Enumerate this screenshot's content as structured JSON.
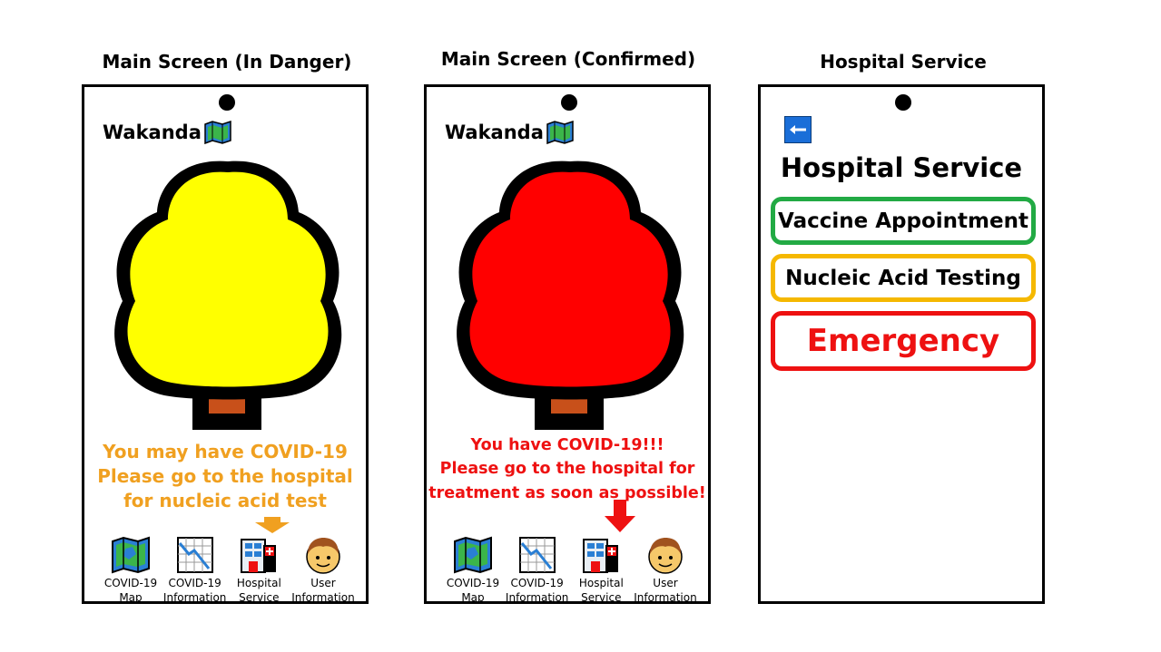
{
  "captions": {
    "danger": "Main Screen (In Danger)",
    "confirmed": "Main Screen (Confirmed)",
    "hospital": "Hospital Service"
  },
  "app": {
    "name": "Wakanda",
    "logo_icon": "folded-map-icon"
  },
  "danger_screen": {
    "tree_color": "#ffff00",
    "message_lines": [
      "You may have COVID-19",
      "Please go to the hospital",
      "for nucleic acid test"
    ],
    "message_color": "#f0a020",
    "arrow_color": "#f0a020"
  },
  "confirmed_screen": {
    "tree_color": "#ff0000",
    "message_lines": [
      "You have COVID-19!!!",
      "Please go to the hospital for",
      "treatment as soon as possible!"
    ],
    "message_color": "#ee1111",
    "arrow_color": "#ee1111"
  },
  "nav": {
    "map": {
      "line1": "COVID-19",
      "line2": "Map",
      "icon": "map-icon"
    },
    "info": {
      "line1": "COVID-19",
      "line2": "Information",
      "icon": "chart-decline-icon"
    },
    "hospital": {
      "line1": "Hospital",
      "line2": "Service",
      "icon": "hospital-icon"
    },
    "user": {
      "line1": "User",
      "line2": "Information",
      "icon": "user-face-icon"
    }
  },
  "hospital_screen": {
    "back_icon": "back-arrow-icon",
    "title": "Hospital Service",
    "buttons": [
      {
        "label": "Vaccine Appointment",
        "color": "#22aa44"
      },
      {
        "label": "Nucleic Acid Testing",
        "color": "#f5b800"
      },
      {
        "label": "Emergency",
        "color": "#ee1111"
      }
    ]
  },
  "colors": {
    "trunk": "#c8501a",
    "back_button": "#1a6ed8"
  }
}
